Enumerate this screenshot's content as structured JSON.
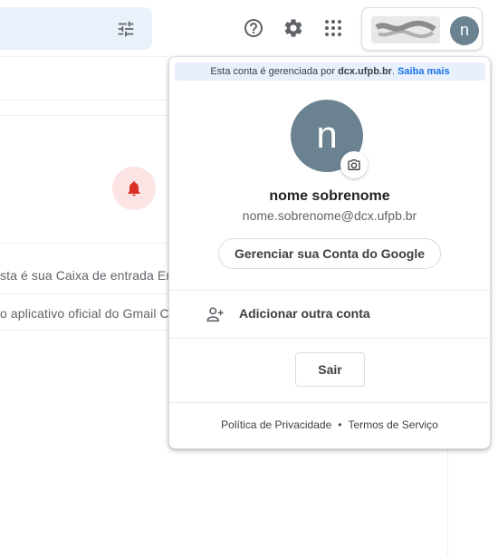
{
  "header": {
    "search_options_icon": "tune-icon",
    "support_icon": "help-circle-icon",
    "settings_icon": "gear-icon",
    "apps_icon": "apps-grid-icon",
    "account_avatar_letter": "n"
  },
  "inbox": {
    "rows": [
      {
        "text": "sta é sua Caixa de entrada Er"
      },
      {
        "text": "o aplicativo oficial do Gmail C"
      }
    ],
    "bell_color": "#d93025"
  },
  "account_popup": {
    "managed_prefix": "Esta conta é gerenciada por ",
    "managed_domain": "dcx.ufpb.br",
    "managed_suffix": ". ",
    "learn_more": "Saiba mais",
    "avatar_letter": "n",
    "name": "nome sobrenome",
    "email": "nome.sobrenome@dcx.ufpb.br",
    "manage_account": "Gerenciar sua Conta do Google",
    "add_account": "Adicionar outra conta",
    "sign_out": "Sair",
    "privacy": "Política de Privacidade",
    "separator": "•",
    "terms": "Termos de Serviço"
  },
  "colors": {
    "avatar_bg": "#6b8290",
    "link_blue": "#1a73e8",
    "banner_bg": "#e8f0fe"
  }
}
